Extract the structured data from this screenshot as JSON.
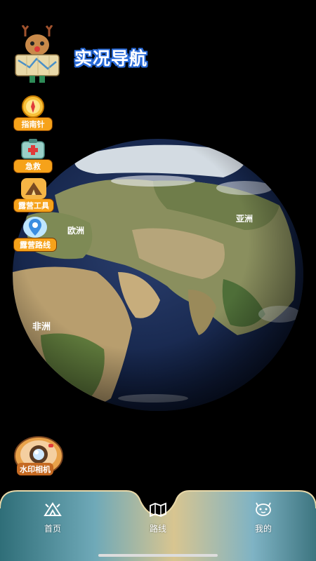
{
  "header": {
    "title": "实况导航"
  },
  "globe": {
    "labels": [
      "欧洲",
      "亚洲",
      "非洲"
    ]
  },
  "tools": [
    {
      "label": "指南针",
      "icon": "compass-icon"
    },
    {
      "label": "急救",
      "icon": "first-aid-icon"
    },
    {
      "label": "露营工具",
      "icon": "tent-icon"
    },
    {
      "label": "露营路线",
      "icon": "map-pin-icon"
    }
  ],
  "camera": {
    "label": "水印相机",
    "icon": "camera-icon"
  },
  "nav": [
    {
      "label": "首页",
      "icon": "tent-icon",
      "active": true
    },
    {
      "label": "路线",
      "icon": "map-icon",
      "active": false
    },
    {
      "label": "我的",
      "icon": "face-icon",
      "active": false
    }
  ],
  "colors": {
    "background": "#000000",
    "title_outline": "#2a6bd8",
    "tool_label_bg": "#f6a21a"
  }
}
